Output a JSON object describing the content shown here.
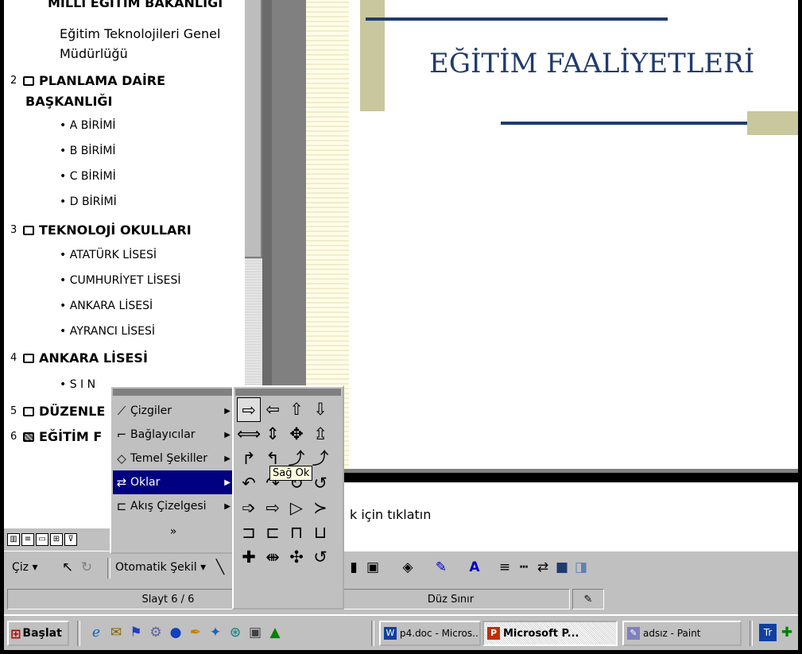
{
  "outline": {
    "rows": [
      {
        "kind": "sub",
        "text": "MİLLİ EĞİTİM BAKANLIĞI"
      },
      {
        "kind": "sub",
        "text": "Eğitim Teknolojileri Genel"
      },
      {
        "kind": "sub",
        "text": "Müdürlüğü"
      },
      {
        "kind": "title",
        "num": "2",
        "text": "PLANLAMA DAİRE"
      },
      {
        "kind": "title2",
        "text": "BAŞKANLIĞI"
      },
      {
        "kind": "bullet",
        "text": "• A BİRİMİ"
      },
      {
        "kind": "bullet",
        "text": "• B BİRİMİ"
      },
      {
        "kind": "bullet",
        "text": "• C BİRİMİ"
      },
      {
        "kind": "bullet",
        "text": "• D BİRİMİ"
      },
      {
        "kind": "title",
        "num": "3",
        "text": "TEKNOLOJİ OKULLARI"
      },
      {
        "kind": "bullet",
        "text": "• ATATÜRK LİSESİ"
      },
      {
        "kind": "bullet",
        "text": "• CUMHURİYET LİSESİ"
      },
      {
        "kind": "bullet",
        "text": "• ANKARA LİSESİ"
      },
      {
        "kind": "bullet",
        "text": "• AYRANCI LİSESİ"
      },
      {
        "kind": "title",
        "num": "4",
        "text": "ANKARA  LİSESİ"
      },
      {
        "kind": "bullet",
        "text": "• S I N"
      },
      {
        "kind": "title",
        "num": "5",
        "text": "DÜZENLE"
      },
      {
        "kind": "title",
        "num": "6",
        "text": "EĞİTİM F"
      }
    ]
  },
  "slide": {
    "title": "EĞİTİM FAALİYETLERİ"
  },
  "notes": {
    "text": "k için tıklatın"
  },
  "draw_menu": {
    "items": [
      {
        "label": "Çizgiler",
        "icon": "lines-icon",
        "glyph": "⟋"
      },
      {
        "label": "Bağlayıcılar",
        "icon": "connectors-icon",
        "glyph": "⌐"
      },
      {
        "label": "Temel Şekiller",
        "icon": "basic-shapes-icon",
        "glyph": "◇"
      },
      {
        "label": "Oklar",
        "icon": "arrows-icon",
        "glyph": "⇄"
      },
      {
        "label": "Akış Çizelgesi",
        "icon": "flowchart-icon",
        "glyph": "⊏"
      }
    ],
    "more": "»"
  },
  "arrows_grid": {
    "glyphs": [
      "⇨",
      "⇦",
      "⇧",
      "⇩",
      "⟺",
      "⇕",
      "✥",
      "⇫",
      "↱",
      "↰",
      "⤴",
      "⤴",
      "↶",
      "↷",
      "↻",
      "↺",
      "➩",
      "⇨",
      "▷",
      "≻",
      "⊐",
      "⊏",
      "⊓",
      "⊔",
      "✚",
      "⇼",
      "✣",
      "↺"
    ],
    "tooltip": "Sağ Ok"
  },
  "toolbar": {
    "draw_label": "Çiz ▾",
    "autoshape_label": "Otomatik Şekil ▾"
  },
  "status": {
    "slide": "Slayt 6 / 6",
    "design": "Düz Sınır"
  },
  "taskbar": {
    "start": "Başlat",
    "tasks": [
      {
        "label": "p4.doc - Micros...",
        "icon": "word-icon"
      },
      {
        "label": "Microsoft P...",
        "icon": "powerpoint-icon"
      },
      {
        "label": "adsız - Paint",
        "icon": "paint-icon"
      }
    ]
  }
}
